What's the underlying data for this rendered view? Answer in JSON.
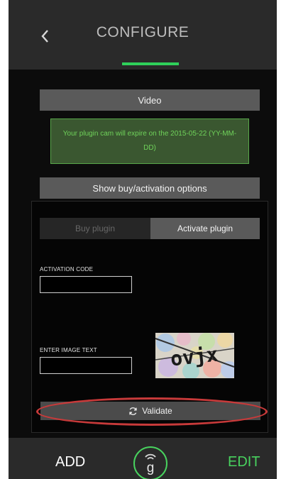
{
  "header": {
    "title": "CONFIGURE",
    "back_icon": "chevron-left-icon",
    "back_glyph": "‹"
  },
  "video_button": {
    "label": "Video"
  },
  "notice": {
    "text": "Your plugin cam will expire on the 2015-05-22 (YY-MM-DD)"
  },
  "options_button": {
    "label": "Show buy/activation options"
  },
  "segments": {
    "buy": "Buy plugin",
    "activate": "Activate plugin"
  },
  "form": {
    "activation_label": "ACTIVATION CODE",
    "activation_value": "",
    "image_label": "ENTER IMAGE TEXT",
    "image_value": "",
    "captcha_text": "ovjx"
  },
  "validate": {
    "label": "Validate",
    "icon": "refresh-icon"
  },
  "bottom": {
    "add": "ADD",
    "edit": "EDIT",
    "logo_letter": "g",
    "logo_icon": "wireless-logo-icon"
  },
  "colors": {
    "accent_green": "#48d25e",
    "highlight_red": "#c83a3a",
    "background": "#0c0c0c"
  }
}
